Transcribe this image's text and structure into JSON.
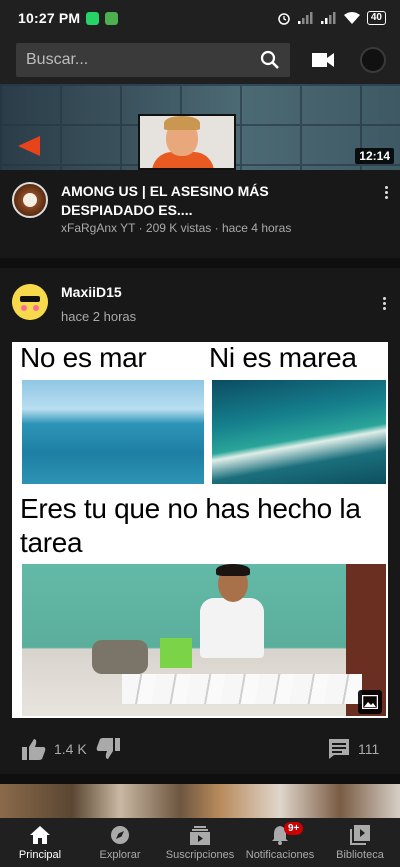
{
  "status_bar": {
    "time": "10:27 PM",
    "battery": "40"
  },
  "search": {
    "placeholder": "Buscar..."
  },
  "video": {
    "duration": "12:14",
    "title": "AMONG US | EL ASESINO MÁS DESPIADADO ES....",
    "channel": "xFaRgAnx YT",
    "views": "209 K vistas",
    "age": "hace 4 horas",
    "meta": "xFaRgAnx YT · 209 K vistas · hace 4 horas"
  },
  "post": {
    "author": "MaxiiD15",
    "time": "hace 2 horas",
    "meme": {
      "line1": "No es mar",
      "line2": "Ni es marea",
      "line3": "Eres tu que no has hecho la tarea"
    },
    "likes": "1.4 K",
    "comments": "111"
  },
  "bottom_nav": {
    "items": [
      {
        "label": "Principal",
        "icon": "home-icon",
        "active": true
      },
      {
        "label": "Explorar",
        "icon": "compass-icon",
        "active": false
      },
      {
        "label": "Suscripciones",
        "icon": "subscriptions-icon",
        "active": false
      },
      {
        "label": "Notificaciones",
        "icon": "bell-icon",
        "active": false,
        "badge": "9+"
      },
      {
        "label": "Biblioteca",
        "icon": "library-icon",
        "active": false
      }
    ]
  },
  "colors": {
    "background": "#181818",
    "bar": "#202020",
    "badge_red": "#cc0000",
    "meta_text": "#aaaaaa"
  }
}
